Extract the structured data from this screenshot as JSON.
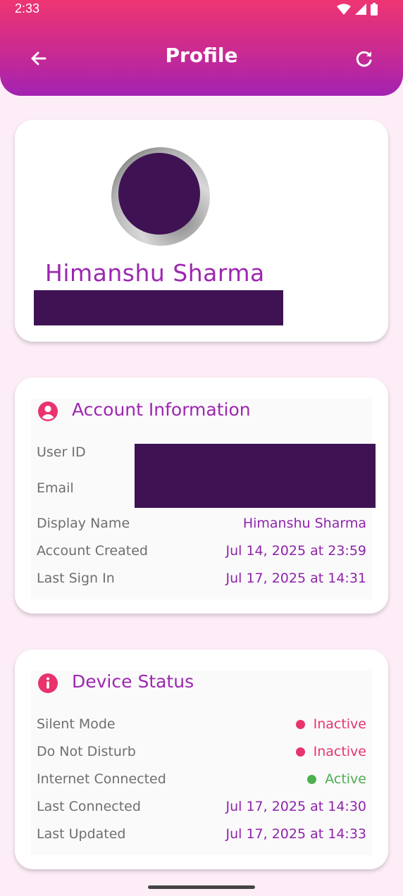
{
  "status_bar": {
    "time": "2:33"
  },
  "header": {
    "title": "Profile",
    "back_icon": "arrow-left-icon",
    "refresh_icon": "refresh-icon"
  },
  "profile": {
    "name": "Himanshu Sharma"
  },
  "account": {
    "title": "Account Information",
    "rows": [
      {
        "label": "User ID",
        "value": ""
      },
      {
        "label": "Email",
        "value": ""
      },
      {
        "label": "Display Name",
        "value": "Himanshu Sharma"
      },
      {
        "label": "Account Created",
        "value": "Jul 14, 2025 at 23:59"
      },
      {
        "label": "Last Sign In",
        "value": "Jul 17, 2025 at 14:31"
      }
    ]
  },
  "device": {
    "title": "Device Status",
    "rows": [
      {
        "label": "Silent Mode",
        "value": "Inactive",
        "status_color": "#e8336c"
      },
      {
        "label": "Do Not Disturb",
        "value": "Inactive",
        "status_color": "#e8336c"
      },
      {
        "label": "Internet Connected",
        "value": "Active",
        "status_color": "#4caf50"
      },
      {
        "label": "Last Connected",
        "value": "Jul 17, 2025 at 14:30"
      },
      {
        "label": "Last Updated",
        "value": "Jul 17, 2025 at 14:33"
      }
    ]
  },
  "colors": {
    "accent": "#9c27b0",
    "pink": "#e8336c",
    "green": "#4caf50",
    "redaction": "#3f1254"
  }
}
